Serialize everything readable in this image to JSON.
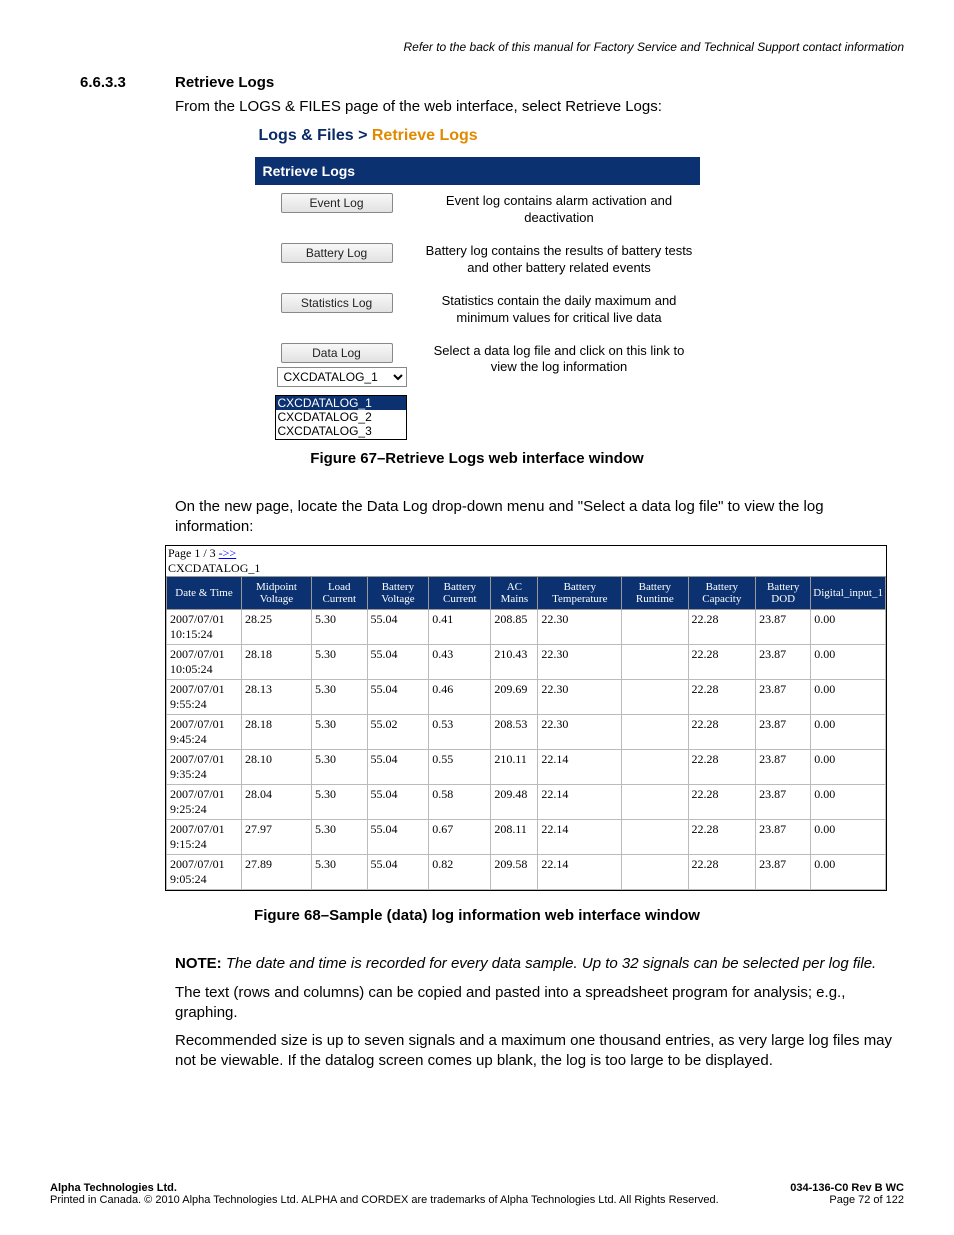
{
  "header_note": "Refer to the back of this manual for Factory Service and Technical Support contact information",
  "section_num": "6.6.3.3",
  "section_title": "Retrieve Logs",
  "intro": "From the LOGS & FILES page of the web interface, select Retrieve Logs:",
  "breadcrumb": {
    "a": "Logs & Files > ",
    "b": "Retrieve Logs"
  },
  "panel_title": "Retrieve Logs",
  "rows": [
    {
      "btn": "Event Log",
      "desc": "Event log contains alarm activation and deactivation"
    },
    {
      "btn": "Battery Log",
      "desc": "Battery log contains the results of battery tests and other battery related events"
    },
    {
      "btn": "Statistics Log",
      "desc": "Statistics contain the daily maximum and minimum values for critical live data"
    },
    {
      "btn": "Data Log",
      "desc": "Select a data log file and click on this link to view the log information"
    }
  ],
  "dropdown_value": "CXCDATALOG_1",
  "dropdown_options": [
    "CXCDATALOG_1",
    "CXCDATALOG_2",
    "CXCDATALOG_3"
  ],
  "fig67": "Figure 67–Retrieve Logs web interface window",
  "para2": "On the new page, locate the Data Log drop-down menu and \"Select a data log file\" to view the log information:",
  "datalog_header": {
    "page": "Page 1 / 3 ",
    "link": "->>",
    "name": "CXCDATALOG_1"
  },
  "columns": [
    "Date & Time",
    "Midpoint Voltage",
    "Load Current",
    "Battery Voltage",
    "Battery Current",
    "AC Mains",
    "Battery Temperature",
    "Battery Runtime",
    "Battery Capacity",
    "Battery DOD",
    "Digital_input_1"
  ],
  "data": [
    [
      "2007/07/01 10:15:24",
      "28.25",
      "5.30",
      "55.04",
      "0.41",
      "208.85",
      "22.30",
      "",
      "22.28",
      "23.87",
      "0.00"
    ],
    [
      "2007/07/01 10:05:24",
      "28.18",
      "5.30",
      "55.04",
      "0.43",
      "210.43",
      "22.30",
      "",
      "22.28",
      "23.87",
      "0.00"
    ],
    [
      "2007/07/01 9:55:24",
      "28.13",
      "5.30",
      "55.04",
      "0.46",
      "209.69",
      "22.30",
      "",
      "22.28",
      "23.87",
      "0.00"
    ],
    [
      "2007/07/01 9:45:24",
      "28.18",
      "5.30",
      "55.02",
      "0.53",
      "208.53",
      "22.30",
      "",
      "22.28",
      "23.87",
      "0.00"
    ],
    [
      "2007/07/01 9:35:24",
      "28.10",
      "5.30",
      "55.04",
      "0.55",
      "210.11",
      "22.14",
      "",
      "22.28",
      "23.87",
      "0.00"
    ],
    [
      "2007/07/01 9:25:24",
      "28.04",
      "5.30",
      "55.04",
      "0.58",
      "209.48",
      "22.14",
      "",
      "22.28",
      "23.87",
      "0.00"
    ],
    [
      "2007/07/01 9:15:24",
      "27.97",
      "5.30",
      "55.04",
      "0.67",
      "208.11",
      "22.14",
      "",
      "22.28",
      "23.87",
      "0.00"
    ],
    [
      "2007/07/01 9:05:24",
      "27.89",
      "5.30",
      "55.04",
      "0.82",
      "209.58",
      "22.14",
      "",
      "22.28",
      "23.87",
      "0.00"
    ]
  ],
  "fig68": "Figure 68–Sample (data) log information web interface window",
  "note_label": "NOTE:",
  "note_text": "The date and time is recorded for every data sample. Up to 32 signals can be selected per log file.",
  "para3": "The text (rows and columns) can be copied and pasted into a spreadsheet program for analysis; e.g., graphing.",
  "para4": "Recommended size is up to seven signals and a maximum one thousand entries, as very large log files may not be viewable. If the datalog screen comes up blank, the log is too large to be displayed.",
  "footer": {
    "company": "Alpha Technologies Ltd.",
    "legal": "Printed in Canada.  © 2010 Alpha Technologies Ltd.  ALPHA and CORDEX are trademarks of Alpha Technologies Ltd.  All Rights Reserved.",
    "doc": "034-136-C0  Rev B  WC",
    "page": "Page 72 of 122"
  }
}
